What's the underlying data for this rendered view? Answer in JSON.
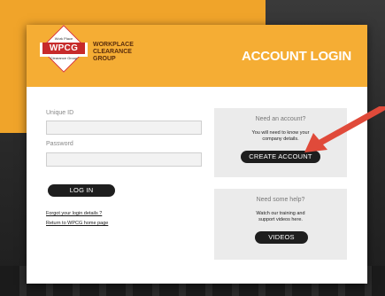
{
  "brand": {
    "logo_top": "Work Place",
    "logo_main": "WPCG",
    "logo_bottom": "Clearance Group",
    "line1": "WORKPLACE",
    "line2": "CLEARANCE",
    "line3": "GROUP"
  },
  "header": {
    "title": "ACCOUNT LOGIN"
  },
  "login": {
    "unique_id_label": "Unique ID",
    "unique_id_value": "",
    "password_label": "Password",
    "password_value": "",
    "login_button": "LOG IN",
    "forgot_link": "Forgot your login details ?",
    "return_link": "Return to WPCG home page"
  },
  "create_account": {
    "title": "Need an account?",
    "text_line1": "You will need to know your",
    "text_line2": "company details.",
    "button": "CREATE ACCOUNT"
  },
  "help": {
    "title": "Need some help?",
    "text_line1": "Watch our training and",
    "text_line2": "support videos here.",
    "button": "VIDEOS"
  },
  "colors": {
    "header_orange": "#f5ad34",
    "arrow_red": "#e04a3a",
    "logo_red": "#c72a2a"
  },
  "icons": {
    "pointer": "arrow-icon"
  }
}
